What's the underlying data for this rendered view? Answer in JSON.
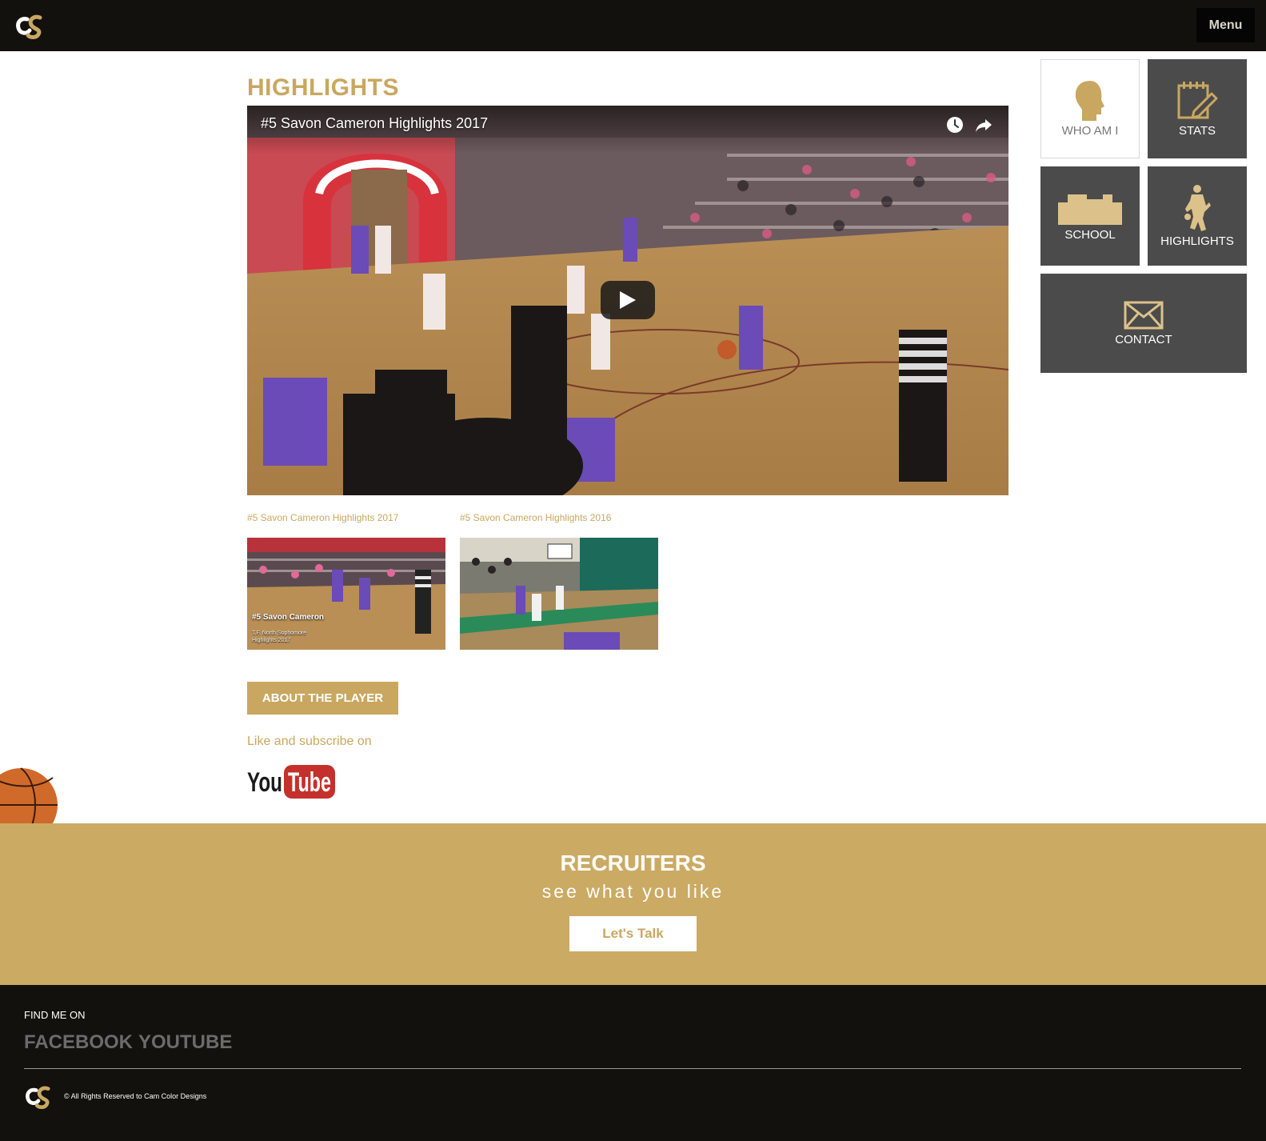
{
  "header": {
    "logo_icon": "cc-monogram-logo",
    "menu_label": "Menu"
  },
  "main": {
    "title": "HIGHLIGHTS",
    "player": {
      "title": "#5 Savon Cameron Highlights 2017",
      "icons": [
        "clock-icon",
        "share-icon",
        "play-icon"
      ]
    },
    "playlist": [
      {
        "caption": "#5 Savon Cameron Highlights 2017",
        "overlay_title": "#5 Savon Cameron",
        "overlay_sub": "T.F. North Sophomore Highlights 2017"
      },
      {
        "caption": "#5 Savon Cameron Highlights 2016"
      }
    ],
    "about_label": "ABOUT THE PLAYER",
    "subscribe_text": "Like and subscribe on",
    "youtube": {
      "you": "You",
      "tube": "Tube"
    }
  },
  "tiles": [
    {
      "label": "WHO AM I",
      "icon": "head-icon"
    },
    {
      "label": "STATS",
      "icon": "notepad-pencil-icon"
    },
    {
      "label": "SCHOOL",
      "icon": "building-icon"
    },
    {
      "label": "HIGHLIGHTS",
      "icon": "basketball-player-icon"
    },
    {
      "label": "CONTACT",
      "icon": "envelope-icon"
    }
  ],
  "recruiters": {
    "title": "RECRUITERS",
    "subtitle": "see what you like",
    "button_label": "Let's Talk"
  },
  "footer": {
    "find_label": "FIND ME ON",
    "links": [
      "FACEBOOK",
      "YOUTUBE"
    ],
    "copyright": "© All Rights Reserved to Cam Color Designs"
  },
  "colors": {
    "gold": "#c9a760",
    "dark": "#13110d",
    "tile_dark": "#4b4b4b"
  }
}
